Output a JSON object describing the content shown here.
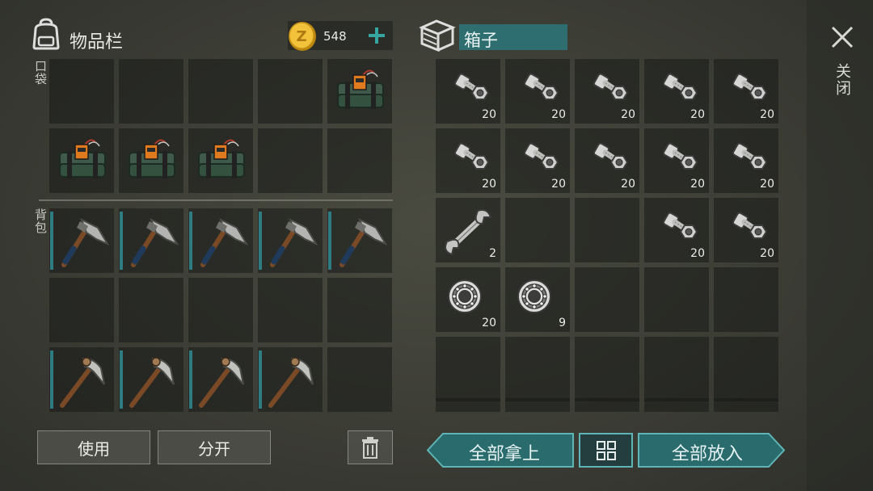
{
  "inventory": {
    "title": "物品栏",
    "pocket_label": "口袋",
    "backpack_label": "背包",
    "coins": "548",
    "coin_icon": "z-coin-icon",
    "pocket_slots": [
      {
        "icon": "empty"
      },
      {
        "icon": "empty"
      },
      {
        "icon": "empty"
      },
      {
        "icon": "empty"
      },
      {
        "icon": "c4-explosive-icon"
      },
      {
        "icon": "c4-explosive-icon"
      },
      {
        "icon": "c4-explosive-icon"
      },
      {
        "icon": "c4-explosive-icon"
      },
      {
        "icon": "empty"
      },
      {
        "icon": "empty"
      }
    ],
    "backpack_slots": [
      {
        "icon": "hatchet-icon"
      },
      {
        "icon": "hatchet-icon"
      },
      {
        "icon": "hatchet-icon"
      },
      {
        "icon": "hatchet-icon"
      },
      {
        "icon": "hatchet-icon"
      },
      {
        "icon": "empty"
      },
      {
        "icon": "empty"
      },
      {
        "icon": "empty"
      },
      {
        "icon": "empty"
      },
      {
        "icon": "empty"
      },
      {
        "icon": "pickaxe-icon"
      },
      {
        "icon": "pickaxe-icon"
      },
      {
        "icon": "pickaxe-icon"
      },
      {
        "icon": "pickaxe-icon"
      },
      {
        "icon": "empty"
      }
    ],
    "use_label": "使用",
    "split_label": "分开"
  },
  "box": {
    "title": "箱子",
    "slots": [
      {
        "icon": "bolt-nut-icon",
        "count": "20"
      },
      {
        "icon": "bolt-nut-icon",
        "count": "20"
      },
      {
        "icon": "bolt-nut-icon",
        "count": "20"
      },
      {
        "icon": "bolt-nut-icon",
        "count": "20"
      },
      {
        "icon": "bolt-nut-icon",
        "count": "20"
      },
      {
        "icon": "bolt-nut-icon",
        "count": "20"
      },
      {
        "icon": "bolt-nut-icon",
        "count": "20"
      },
      {
        "icon": "bolt-nut-icon",
        "count": "20"
      },
      {
        "icon": "bolt-nut-icon",
        "count": "20"
      },
      {
        "icon": "bolt-nut-icon",
        "count": "20"
      },
      {
        "icon": "wrench-icon",
        "count": "2"
      },
      {
        "icon": "empty",
        "count": ""
      },
      {
        "icon": "empty",
        "count": ""
      },
      {
        "icon": "bolt-nut-icon",
        "count": "20"
      },
      {
        "icon": "bolt-nut-icon",
        "count": "20"
      },
      {
        "icon": "bearing-icon",
        "count": "20"
      },
      {
        "icon": "bearing-icon",
        "count": "9"
      },
      {
        "icon": "empty",
        "count": ""
      },
      {
        "icon": "empty",
        "count": ""
      },
      {
        "icon": "empty",
        "count": ""
      },
      {
        "icon": "empty",
        "count": ""
      },
      {
        "icon": "empty",
        "count": ""
      },
      {
        "icon": "empty",
        "count": ""
      },
      {
        "icon": "empty",
        "count": ""
      },
      {
        "icon": "empty",
        "count": ""
      }
    ],
    "take_all_label": "全部拿上",
    "put_all_label": "全部放入"
  },
  "close_label": "关闭",
  "colors": {
    "accent": "#2f6e70",
    "teal_button": "#2a6b6d",
    "teal_border": "#5fb5b5",
    "durability": "#2e7c82"
  }
}
